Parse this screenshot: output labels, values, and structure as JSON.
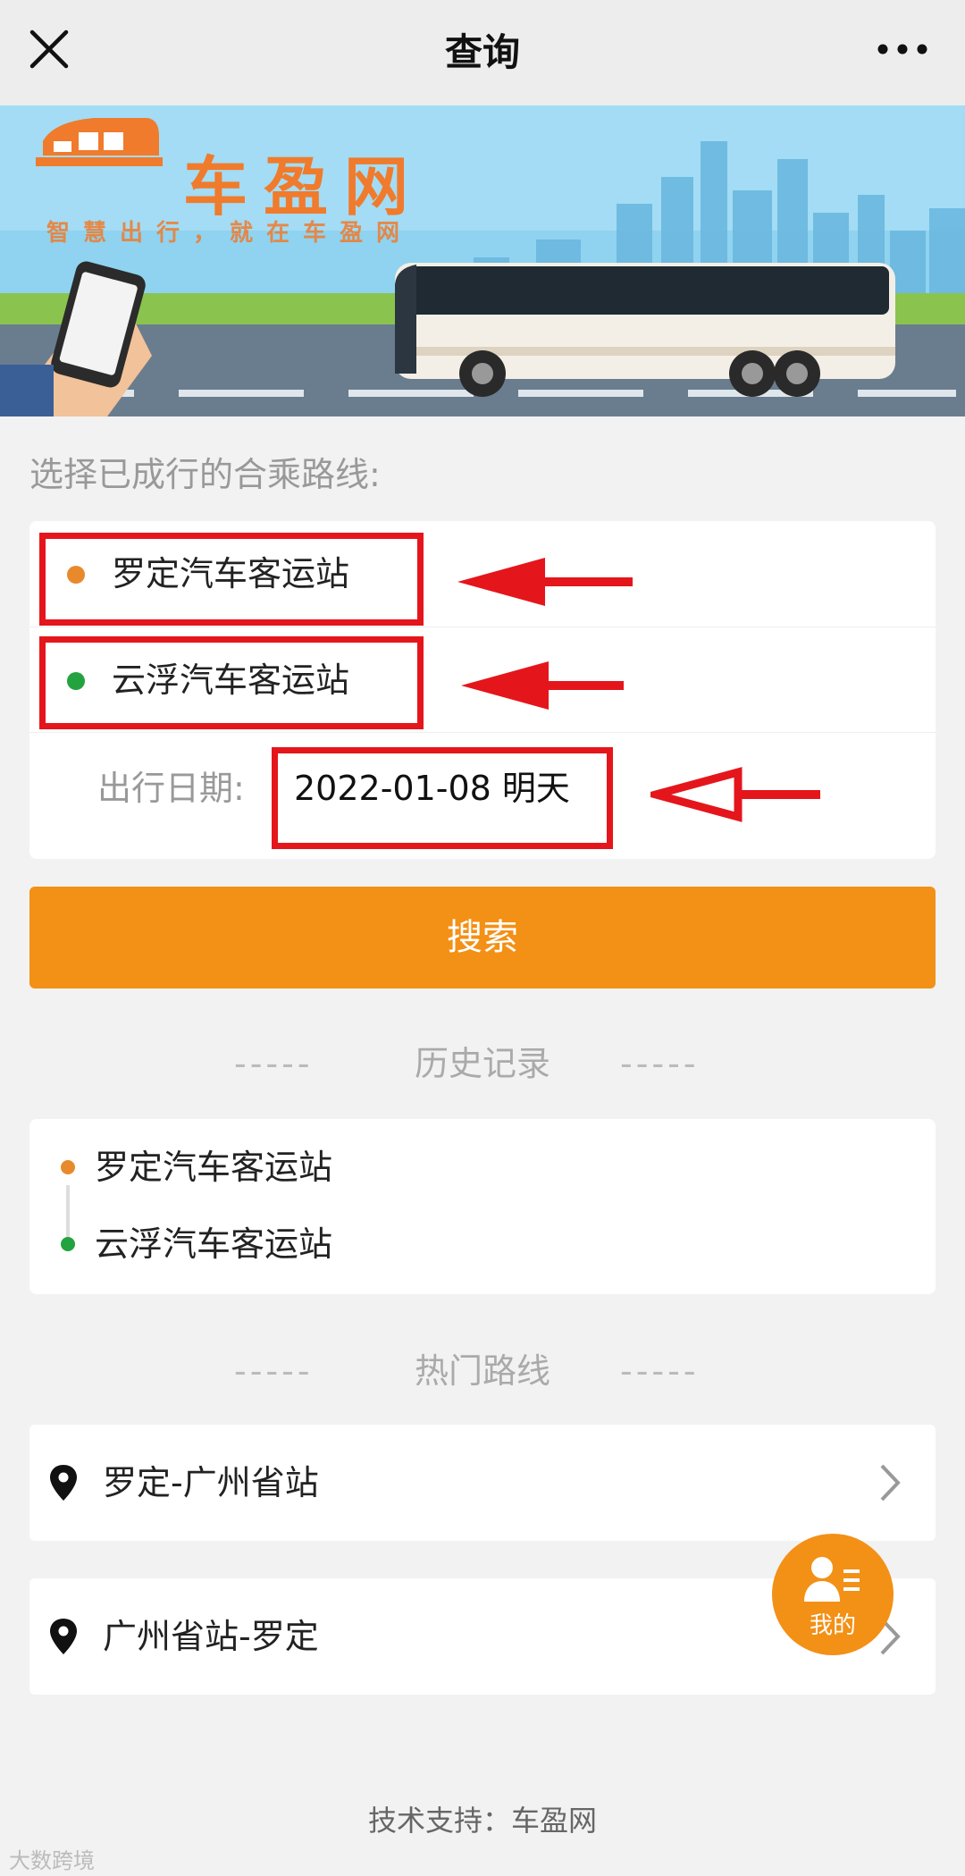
{
  "navbar": {
    "title": "查询",
    "close_icon": "close-icon",
    "more_icon": "more-dots-icon"
  },
  "banner": {
    "brand_name": "车盈网",
    "slogan": "智慧出行，就在车盈网"
  },
  "route_section": {
    "label": "选择已成行的合乘路线:",
    "origin": "罗定汽车客运站",
    "destination": "云浮汽车客运站",
    "date_label": "出行日期:",
    "date_value": "2022-01-08 明天",
    "origin_color": "#e88a2c",
    "destination_color": "#22a33f"
  },
  "search_button": {
    "label": "搜索",
    "color": "#f39016"
  },
  "history": {
    "title": "历史记录",
    "dashes": "-----",
    "items": [
      {
        "from": "罗定汽车客运站",
        "to": "云浮汽车客运站"
      }
    ]
  },
  "hot_routes": {
    "title": "热门路线",
    "dashes": "-----",
    "items": [
      {
        "label": "罗定-广州省站"
      },
      {
        "label": "广州省站-罗定"
      }
    ]
  },
  "floating_button": {
    "label": "我的",
    "icon": "user-list-icon"
  },
  "footer": {
    "text": "技术支持：车盈网"
  },
  "watermark": {
    "text": "大数跨境"
  },
  "annotation_color": "#e4161c"
}
